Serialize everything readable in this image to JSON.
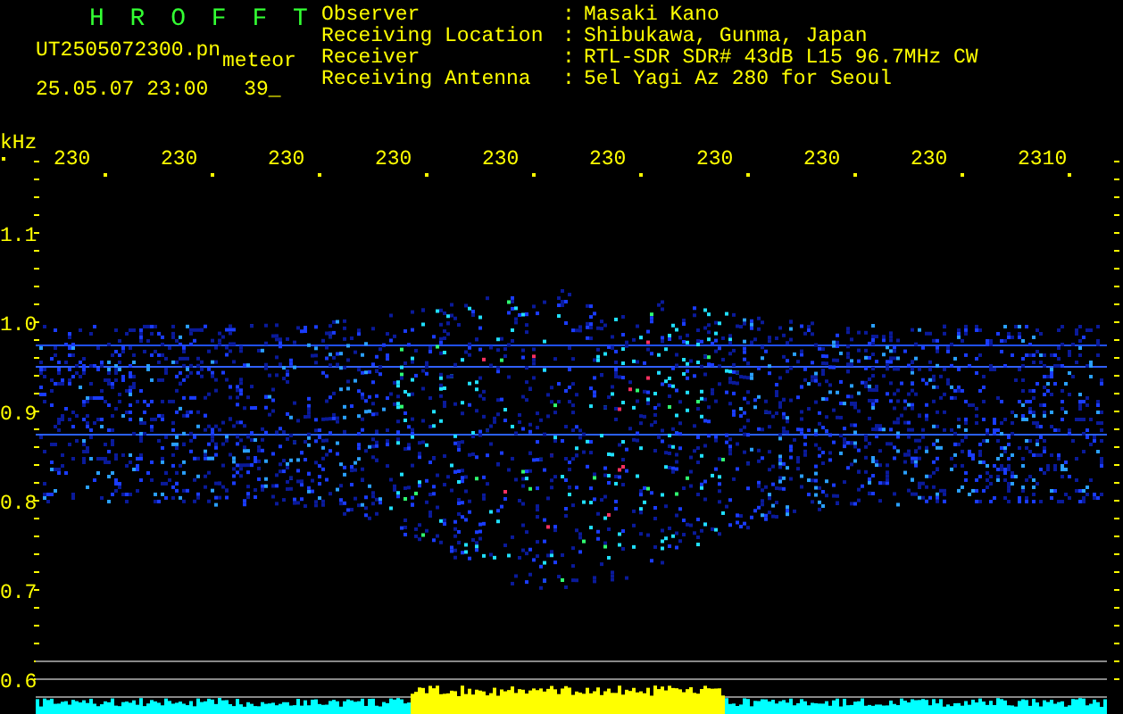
{
  "title": "H R O F F T",
  "file_name": "UT2505072300.pn",
  "tag": "meteor",
  "timestamp": "25.05.07 23:00",
  "count": "39_",
  "info": [
    {
      "label": "Observer",
      "separator": ":",
      "value": "Masaki Kano"
    },
    {
      "label": "Receiving Location",
      "separator": ":",
      "value": "Shibukawa, Gunma, Japan"
    },
    {
      "label": "Receiver",
      "separator": ":",
      "value": "RTL-SDR SDR# 43dB L15 96.7MHz CW"
    },
    {
      "label": "Receiving Antenna",
      "separator": ":",
      "value": "5el Yagi Az 280 for Seoul"
    }
  ],
  "y_unit": "kHz",
  "x_labels": [
    "230",
    "230",
    "230",
    "230",
    "230",
    "230",
    "230",
    "230",
    "230",
    "2310"
  ],
  "y_labels": [
    "1.1",
    "1.0",
    "0.9",
    "0.8",
    "0.7",
    "0.6"
  ]
}
